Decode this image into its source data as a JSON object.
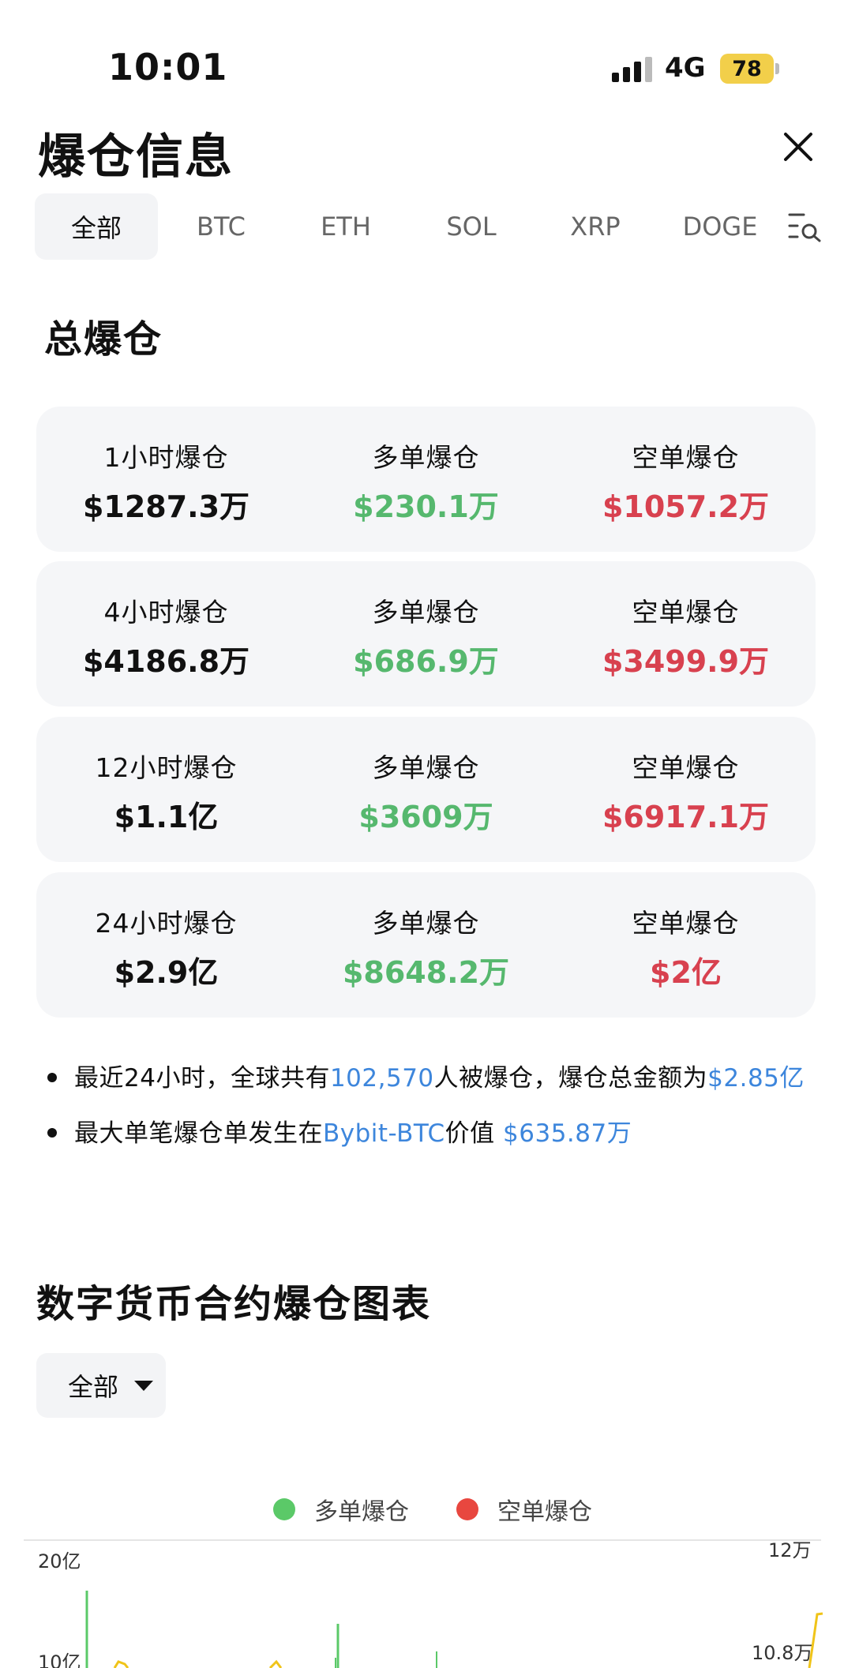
{
  "status": {
    "time": "10:01",
    "network": "4G",
    "battery": "78"
  },
  "header": {
    "title": "爆仓信息"
  },
  "tabs": [
    "全部",
    "BTC",
    "ETH",
    "SOL",
    "XRP",
    "DOGE"
  ],
  "summary": {
    "title": "总爆仓",
    "rows": [
      {
        "total_label": "1小时爆仓",
        "total": "$1287.3万",
        "long_label": "多单爆仓",
        "long": "$230.1万",
        "short_label": "空单爆仓",
        "short": "$1057.2万"
      },
      {
        "total_label": "4小时爆仓",
        "total": "$4186.8万",
        "long_label": "多单爆仓",
        "long": "$686.9万",
        "short_label": "空单爆仓",
        "short": "$3499.9万"
      },
      {
        "total_label": "12小时爆仓",
        "total": "$1.1亿",
        "long_label": "多单爆仓",
        "long": "$3609万",
        "short_label": "空单爆仓",
        "short": "$6917.1万"
      },
      {
        "total_label": "24小时爆仓",
        "total": "$2.9亿",
        "long_label": "多单爆仓",
        "long": "$8648.2万",
        "short_label": "空单爆仓",
        "short": "$2亿"
      }
    ]
  },
  "notes": {
    "line1_prefix": "最近24小时，全球共有",
    "line1_count": "102,570",
    "line1_middle": "人被爆仓，爆仓总金额为",
    "line1_amount": "$2.85亿",
    "line2_prefix": "最大单笔爆仓单发生在",
    "line2_exchange": "Bybit-BTC",
    "line2_middle": "价值 ",
    "line2_amount": "$635.87万"
  },
  "chart_section": {
    "title": "数字货币合约爆仓图表",
    "filter_value": "全部",
    "legend_long": "多单爆仓",
    "legend_short": "空单爆仓"
  },
  "chart_data": {
    "type": "bar",
    "series": [
      {
        "name": "多单爆仓",
        "color": "#5bc968"
      },
      {
        "name": "空单爆仓",
        "color": "#e8473f"
      }
    ],
    "y_left_ticks": [
      "20亿",
      "10亿"
    ],
    "y_right_ticks": [
      "12万",
      "10.8万"
    ]
  },
  "colors": {
    "long": "#56b86e",
    "short": "#d8414f",
    "link": "#3d86dc"
  }
}
